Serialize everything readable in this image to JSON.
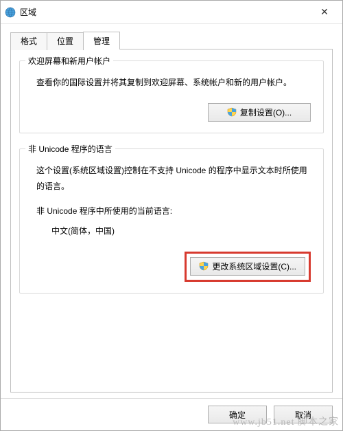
{
  "window": {
    "title": "区域",
    "close_glyph": "✕"
  },
  "tabs": {
    "format": "格式",
    "location": "位置",
    "admin": "管理"
  },
  "group_welcome": {
    "title": "欢迎屏幕和新用户帐户",
    "desc": "查看你的国际设置并将其复制到欢迎屏幕、系统帐户和新的用户帐户。",
    "copy_button": "复制设置(O)..."
  },
  "group_nonunicode": {
    "title": "非 Unicode 程序的语言",
    "desc": "这个设置(系统区域设置)控制在不支持 Unicode 的程序中显示文本时所使用的语言。",
    "current_label": "非 Unicode 程序中所使用的当前语言:",
    "current_value": "中文(简体，中国)",
    "change_button": "更改系统区域设置(C)..."
  },
  "footer": {
    "ok": "确定",
    "cancel": "取消"
  },
  "watermark": "www.jb51.net 脚本之家"
}
